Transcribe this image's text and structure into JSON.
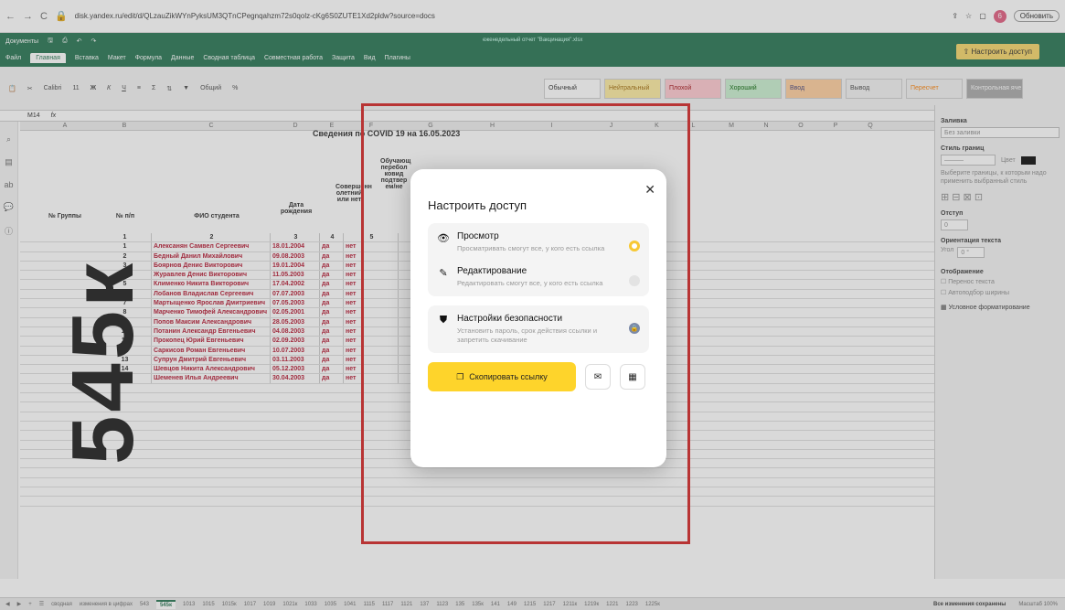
{
  "browser": {
    "url": "disk.yandex.ru/edit/d/QLzauZikWYnPyksUM3QTnCPegnqahzm72s0qolz-cKg6S0ZUTE1Xd2pldw?source=docs",
    "update": "Обновить",
    "avatar": "6"
  },
  "app": {
    "docs_label": "Документы",
    "file_title": "еженедельный отчет \"Вакцинация\".xlsx",
    "share_label": "Настроить доступ",
    "menu": [
      "Файл",
      "Главная",
      "Вставка",
      "Макет",
      "Формула",
      "Данные",
      "Сводная таблица",
      "Совместная работа",
      "Защита",
      "Вид",
      "Плагины"
    ]
  },
  "ribbon": {
    "font": "Calibri",
    "size": "11",
    "format": "Общий",
    "styles": [
      {
        "name": "Обычный",
        "bg": "#ffffff",
        "fg": "#222"
      },
      {
        "name": "Нейтральный",
        "bg": "#fdeb9c",
        "fg": "#9c6500"
      },
      {
        "name": "Плохой",
        "bg": "#ffc7ce",
        "fg": "#9c0006"
      },
      {
        "name": "Хороший",
        "bg": "#c6efce",
        "fg": "#006100"
      },
      {
        "name": "Ввод",
        "bg": "#ffcc99",
        "fg": "#3f3f76"
      },
      {
        "name": "Вывод",
        "bg": "#f2f2f2",
        "fg": "#3f3f3f"
      },
      {
        "name": "Пересчет",
        "bg": "#f2f2f2",
        "fg": "#fa7d00"
      },
      {
        "name": "Контрольная яче",
        "bg": "#a5a5a5",
        "fg": "#fff"
      }
    ]
  },
  "formula": {
    "cell": "M14",
    "fx": "fx"
  },
  "sheet": {
    "columns": [
      "A",
      "B",
      "C",
      "D",
      "E",
      "F",
      "G",
      "H",
      "I",
      "J",
      "K",
      "L",
      "M",
      "N",
      "O",
      "P",
      "Q"
    ],
    "title": "Сведения по COVID 19 на 16.05.2023",
    "headers": {
      "group": "№ Группы",
      "num": "№ п/п",
      "fio": "ФИО студента",
      "dob": "Дата рождения",
      "vacc": "Совершенн олетний или нет",
      "obuch": "Обучающ перебол ковид подтвер ем/не"
    },
    "idx": [
      "1",
      "2",
      "3",
      "4",
      "5"
    ],
    "students": [
      {
        "n": "1",
        "fio": "Алексанян Самвел Сергеевич",
        "dob": "18.01.2004"
      },
      {
        "n": "2",
        "fio": "Бедный Данил Михайлович",
        "dob": "09.08.2003"
      },
      {
        "n": "3",
        "fio": "Боярнов Денис Викторович",
        "dob": "19.01.2004"
      },
      {
        "n": "4",
        "fio": "Журавлев Денис Викторович",
        "dob": "11.05.2003"
      },
      {
        "n": "5",
        "fio": "Клименко Никита Викторович",
        "dob": "17.04.2002"
      },
      {
        "n": "6",
        "fio": "Лобанов Владислав Сергеевич",
        "dob": "07.07.2003"
      },
      {
        "n": "7",
        "fio": "Мартыщенко Ярослав Дмитриевич",
        "dob": "07.05.2003"
      },
      {
        "n": "8",
        "fio": "Марченко Тимофей Александрович",
        "dob": "02.05.2001"
      },
      {
        "n": "9",
        "fio": "Попов Максим Александрович",
        "dob": "28.05.2003"
      },
      {
        "n": "10",
        "fio": "Потанин Александр Евгеньевич",
        "dob": "04.08.2003"
      },
      {
        "n": "11",
        "fio": "Прокопец Юрий Евгеньевич",
        "dob": "02.09.2003"
      },
      {
        "n": "12",
        "fio": "Саркисов Роман Евгеньевич",
        "dob": "10.07.2003"
      },
      {
        "n": "13",
        "fio": "Супрун Дмитрий Евгеньевич",
        "dob": "03.11.2003"
      },
      {
        "n": "14",
        "fio": "Шевцов Никита Александрович",
        "dob": "05.12.2003"
      },
      {
        "n": "15",
        "fio": "Шеменев Илья Андреевич",
        "dob": "30.04.2003"
      }
    ],
    "yes": "да",
    "no": "нет",
    "group_value": "545к"
  },
  "panel": {
    "fill": "Заливка",
    "fill_value": "Без заливки",
    "border_style": "Стиль границ",
    "color": "Цвет",
    "border_hint": "Выберите границы, к которым надо применить выбранный стиль",
    "indent": "Отступ",
    "indent_value": "0",
    "orient": "Ориентация текста",
    "angle": "Угол",
    "angle_value": "0 °",
    "display": "Отображение",
    "wrap": "Перенос текста",
    "autofit": "Автоподбор ширины",
    "cond": "Условное форматирование"
  },
  "modal": {
    "title": "Настроить доступ",
    "view_title": "Просмотр",
    "view_desc": "Просматривать смогут все, у кого есть ссылка",
    "edit_title": "Редактирование",
    "edit_desc": "Редактировать смогут все, у кого есть ссылка",
    "sec_title": "Настройки безопасности",
    "sec_desc": "Установить пароль, срок действия ссылки и запретить скачивание",
    "copy": "Скопировать ссылку"
  },
  "tabs": {
    "items": [
      "сводная",
      "изменения в цифрах",
      "543",
      "545к",
      "1013",
      "1015",
      "1015к",
      "1017",
      "1019",
      "1021к",
      "1033",
      "1035",
      "1041",
      "1115",
      "1117",
      "1121",
      "137",
      "1123",
      "135",
      "135к",
      "141",
      "149",
      "1215",
      "1217",
      "1211к",
      "1219к",
      "1221",
      "1223",
      "1225к"
    ],
    "active": "545к",
    "status": "Все изменения сохранены",
    "zoom": "Масштаб 100%"
  }
}
